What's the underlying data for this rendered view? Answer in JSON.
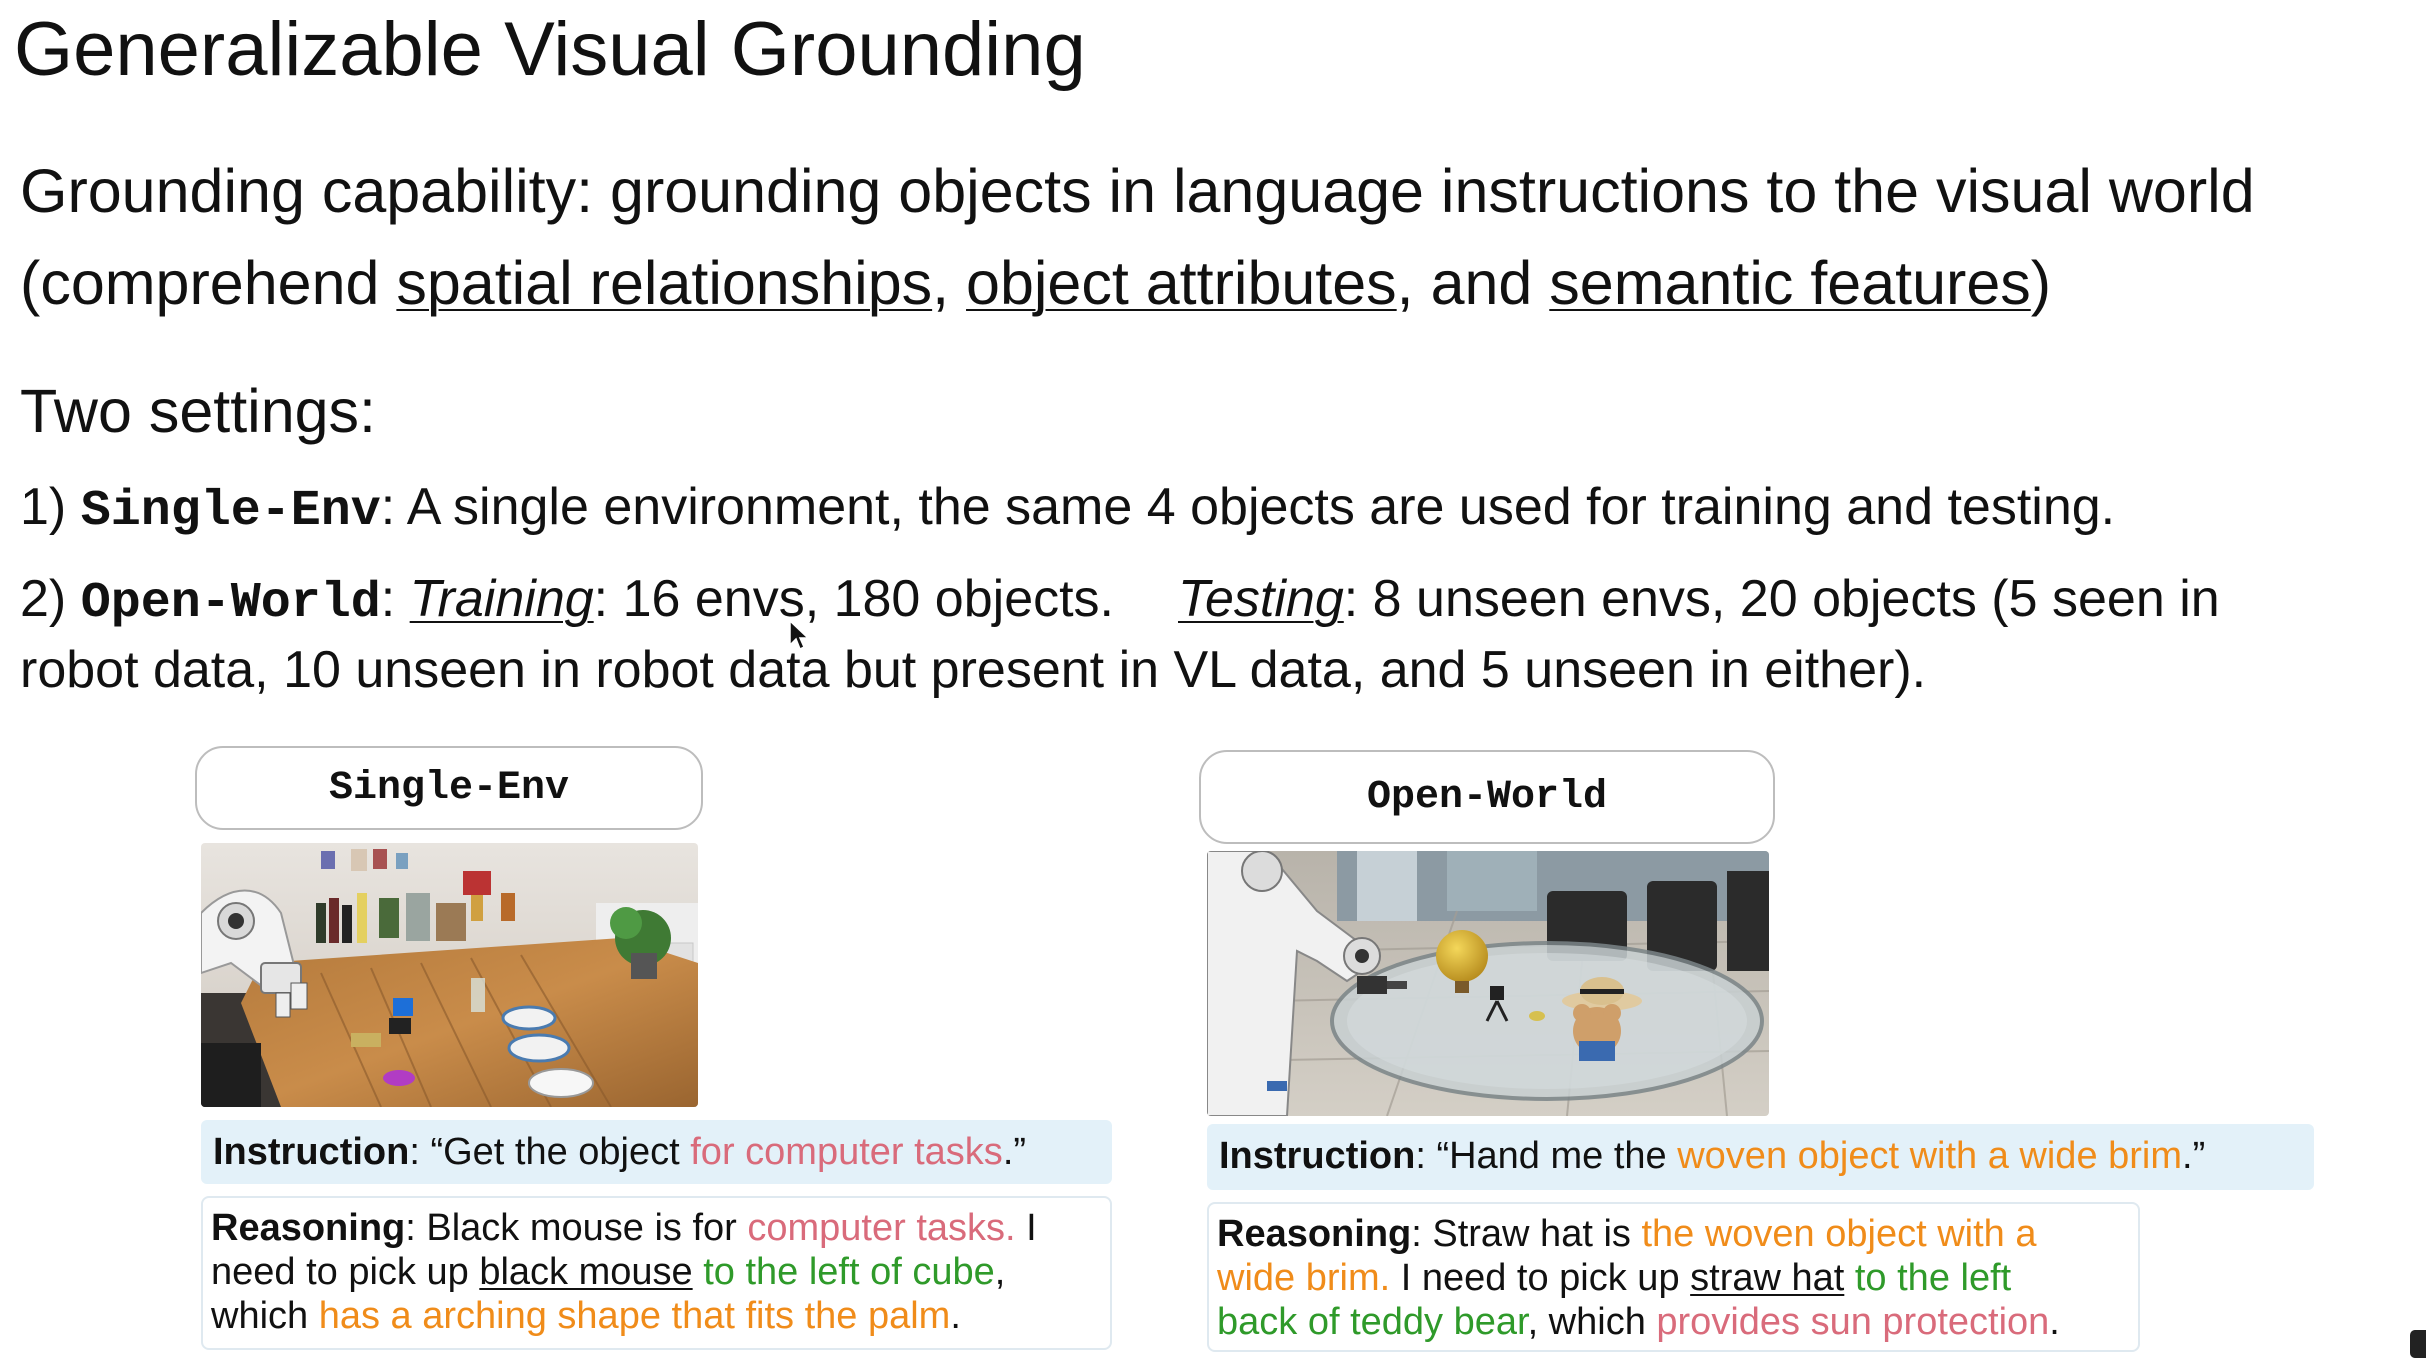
{
  "slide": {
    "title": "Generalizable Visual Grounding",
    "grounding": {
      "line1": "Grounding capability: grounding objects in language instructions to the visual world",
      "line2_prefix": "(comprehend ",
      "term1": "spatial relationships",
      "sep1": ", ",
      "term2": "object attributes",
      "sep2": ", and ",
      "term3": "semantic features",
      "line2_suffix": ")"
    },
    "settings_title": "Two settings:",
    "setting1": {
      "num": "1) ",
      "name": "Single-Env",
      "text": ": A single environment, the same 4 objects are used for training and testing."
    },
    "setting2": {
      "num": "2) ",
      "name": "Open-World",
      "colon": ": ",
      "training_label": "Training",
      "training_text": ": 16 envs, 180 objects.",
      "testing_label": "Testing",
      "testing_text": ": 8 unseen envs, 20 objects (5 seen in",
      "line2": "robot data, 10 unseen in robot data but present in VL data, and 5 unseen in either)."
    }
  },
  "panels": {
    "single_env": {
      "label": "Single-Env",
      "instruction": {
        "label": "Instruction",
        "pre": ": “Get the object ",
        "highlight": "for computer tasks",
        "post": ".”"
      },
      "reasoning": {
        "label": "Reasoning",
        "l1_pre": ": Black mouse is for ",
        "l1_hl": "computer tasks.",
        "l1_post": " I",
        "l2_pre": "need to pick up ",
        "l2_obj": "black mouse",
        "l2_sp": " ",
        "l2_hl": "to the left of cube",
        "l2_post": ",",
        "l3_pre": "which ",
        "l3_hl": "has a arching shape that fits the palm",
        "l3_post": "."
      }
    },
    "open_world": {
      "label": "Open-World",
      "instruction": {
        "label": "Instruction",
        "pre": ":  “Hand me the ",
        "highlight": "woven object with a wide brim",
        "post": ".”"
      },
      "reasoning": {
        "label": "Reasoning",
        "l1_pre": ": Straw hat is ",
        "l1_hl": "the woven object with a",
        "l2_hl": "wide brim.",
        "l2_pre": " I need to pick up ",
        "l2_obj": "straw hat",
        "l2_sp": " ",
        "l2_hl2": "to the left",
        "l3_hl": "back of teddy bear",
        "l3_mid": ", which ",
        "l3_hl2": "provides sun protection",
        "l3_post": "."
      }
    }
  },
  "colors": {
    "semantic_highlight": "#d96b7b",
    "attribute_highlight": "#f08c1a",
    "spatial_highlight": "#2f9a2a",
    "instruction_bg": "#e3f1f9"
  }
}
